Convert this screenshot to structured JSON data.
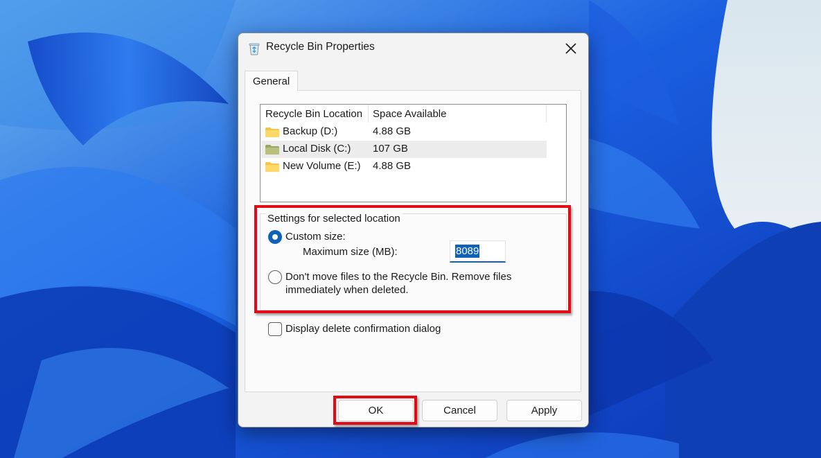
{
  "dialog": {
    "title": "Recycle Bin Properties",
    "tab_general": "General"
  },
  "list": {
    "columns": [
      "Recycle Bin Location",
      "Space Available"
    ],
    "rows": [
      {
        "name": "Backup (D:)",
        "space": "4.88 GB"
      },
      {
        "name": "Local Disk (C:)",
        "space": "107 GB"
      },
      {
        "name": "New Volume (E:)",
        "space": "4.88 GB"
      }
    ],
    "selected_index": 1
  },
  "settings": {
    "group_label": "Settings for selected location",
    "custom_size_label": "Custom size:",
    "max_size_label": "Maximum size (MB):",
    "max_size_value": "8089",
    "dont_move_line1": "Don't move files to the Recycle Bin. Remove files",
    "dont_move_line2": "immediately when deleted.",
    "selected_option": "custom_size"
  },
  "confirm_checkbox": {
    "label": "Display delete confirmation dialog",
    "checked": false
  },
  "buttons": {
    "ok": "OK",
    "cancel": "Cancel",
    "apply": "Apply"
  },
  "colors": {
    "accent": "#0f62b8",
    "highlight": "#e00b16",
    "wallpaper": "#1650d8"
  }
}
